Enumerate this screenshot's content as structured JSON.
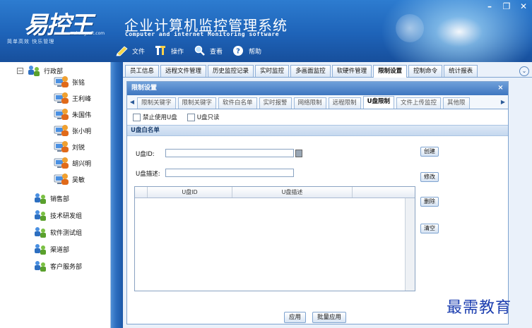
{
  "header": {
    "logo_text": "易控王",
    "logo_url": "ekongsoft.com",
    "logo_slogan": "简单高效 快乐管理",
    "title": "企业计算机监控管理系统",
    "subtitle": "Computer and internet Monitoring software",
    "toolbar": [
      {
        "label": "文件",
        "icon": "pencil-icon"
      },
      {
        "label": "操作",
        "icon": "tools-icon"
      },
      {
        "label": "查看",
        "icon": "search-icon"
      },
      {
        "label": "帮助",
        "icon": "help-icon"
      }
    ],
    "window": {
      "minimize": "–",
      "maximize": "❐",
      "close": "✕"
    }
  },
  "tree": {
    "root": {
      "label": "行政部",
      "expander": "−"
    },
    "users": [
      "张铭",
      "王利峰",
      "朱国伟",
      "张小明",
      "刘锐",
      "胡兴明",
      "吴敏"
    ],
    "groups": [
      "销售部",
      "技术研发组",
      "软件测试组",
      "渠道部",
      "客户服务部"
    ]
  },
  "tabs": {
    "items": [
      "员工信息",
      "远程文件管理",
      "历史监控记录",
      "实时监控",
      "多画面监控",
      "软硬件管理",
      "限制设置",
      "控制命令",
      "统计报表"
    ],
    "active": "限制设置",
    "nav_arrow": "⌄"
  },
  "panel": {
    "title": "限制设置",
    "close": "×",
    "sub_tabs": [
      "限制关键字",
      "限制关键字",
      "软件白名单",
      "实时报警",
      "网络限制",
      "远程限制",
      "U盘限制",
      "文件上传监控",
      "其他限"
    ],
    "active_sub_tab": "U盘限制",
    "checkboxes": [
      {
        "label": "禁止使用U盘",
        "checked": false
      },
      {
        "label": "U盘只读",
        "checked": false
      }
    ],
    "section_title": "U盘白名单",
    "form": {
      "id_label": "U盘ID:",
      "id_value": "",
      "desc_label": "U盘描述:",
      "desc_value": ""
    },
    "buttons": {
      "create": "创建",
      "modify": "修改",
      "delete": "删除",
      "clear": "清空"
    },
    "list_columns": [
      "U盘ID",
      "U盘描述"
    ],
    "footer": {
      "apply": "应用",
      "batch_apply": "批量应用"
    }
  },
  "watermark": "最需教育"
}
